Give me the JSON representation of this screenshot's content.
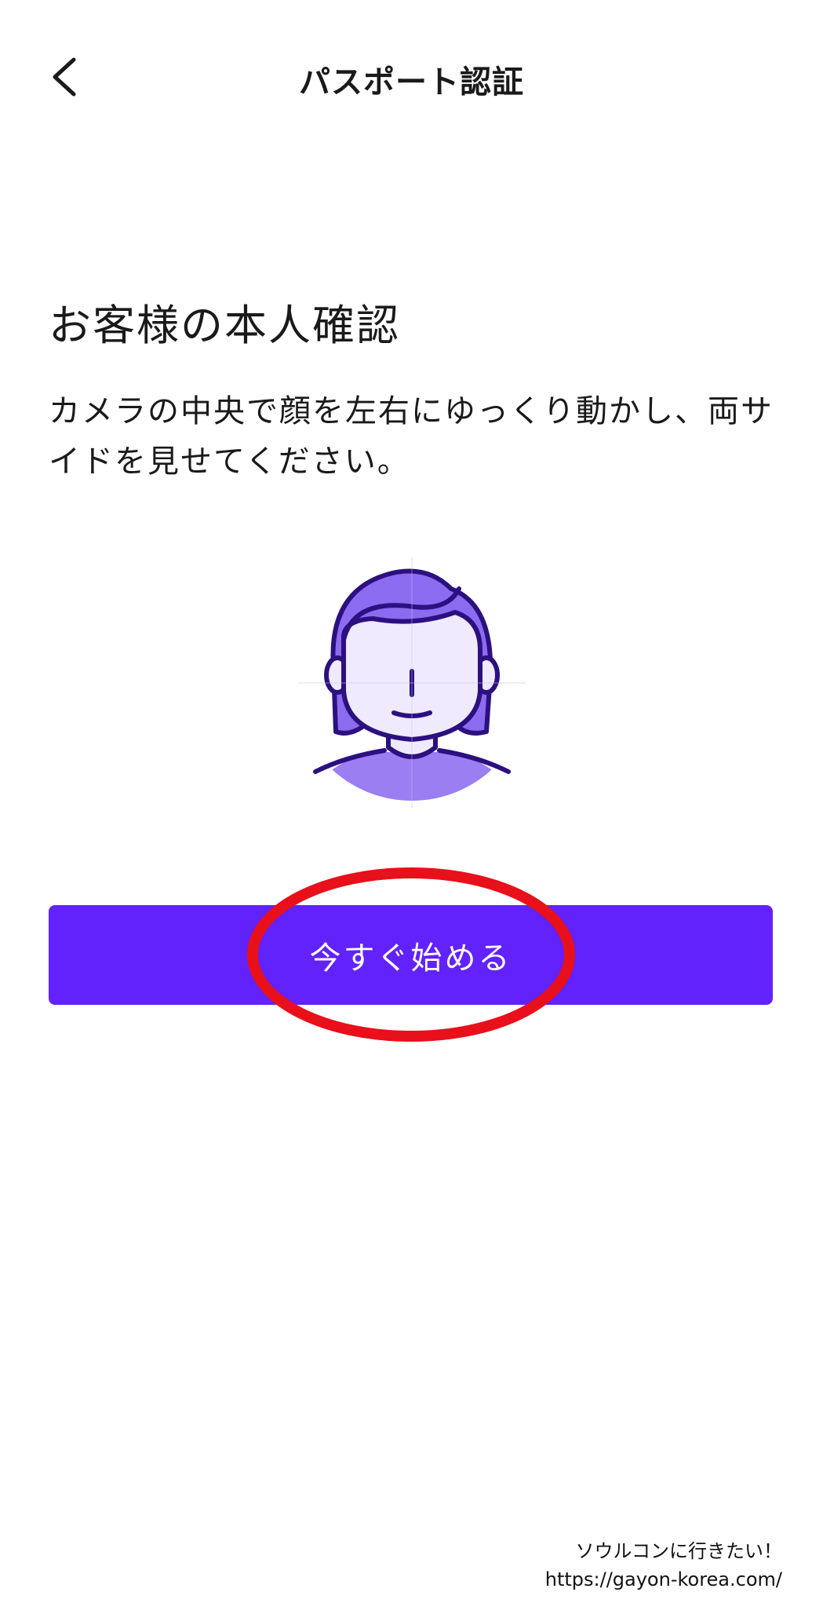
{
  "header": {
    "title": "パスポート認証",
    "back_icon": "chevron-left-icon"
  },
  "main": {
    "heading": "お客様の本人確認",
    "instructions": "カメラの中央で顔を左右にゆっくり動かし、両サイドを見せてください。",
    "illustration_icon": "face-portrait-icon",
    "start_button_label": "今すぐ始める"
  },
  "overlay": {
    "highlight_color": "#e8101a"
  },
  "watermark": {
    "line1": "ソウルコンに行きたい！",
    "line2": "https://gayon-korea.com/"
  },
  "colors": {
    "accent": "#6122fb",
    "illustration_dark": "#2c1080",
    "illustration_hair": "#8b6cf0",
    "illustration_skin": "#efeafd"
  }
}
